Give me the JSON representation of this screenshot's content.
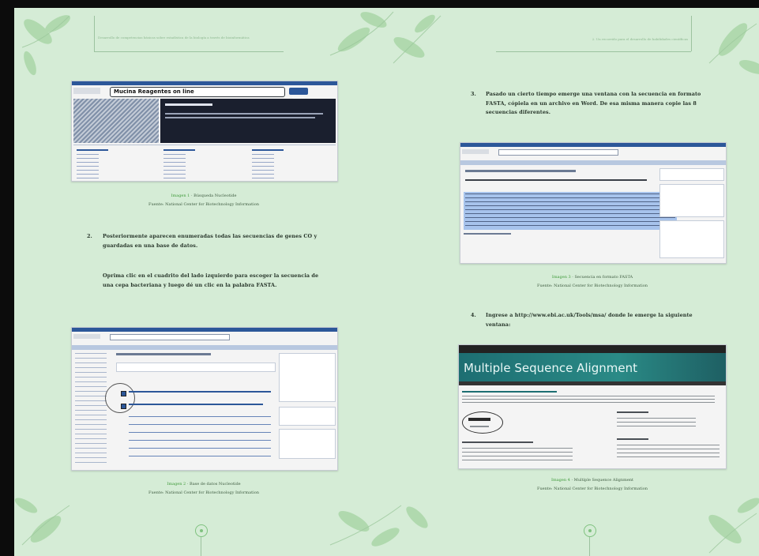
{
  "left_page": {
    "header": "Desarrollo de competencias básicas sobre estadística de la biología a través de bioinformática",
    "figure1": {
      "search_query": "Mucina Reagentes on line",
      "search_button": "Search",
      "caption_label": "Imagen 1",
      "caption_title": "Búsqueda Nucleotide",
      "source": "Fuente: National Center for Biotechnology Information"
    },
    "step2": {
      "number": "2.",
      "text_a": "Posteriormente aparecen enumeradas todas las secuencias de genes CO y guardadas en una base de datos.",
      "text_b": "Oprima clic en el cuadrito del lado izquierdo para escoger la secuencia de una cepa bacteriana y luego dé un clic en la palabra FASTA."
    },
    "figure2": {
      "caption_label": "Imagen 2",
      "caption_title": "Base de datos Nucleotide",
      "source": "Fuente: National Center for Biotechnology Information"
    }
  },
  "right_page": {
    "header": "2. Un recorrido para el desarrollo de habilidades científicas",
    "step3": {
      "number": "3.",
      "text": "Pasado un cierto tiempo emerge una ventana con la secuencia en formato FASTA, cópiela en un archivo en Word. De esa misma manera copie las 8 secuencias diferentes."
    },
    "figure3": {
      "caption_label": "Imagen 3",
      "caption_title": "Secuencia en formato FASTA",
      "source": "Fuente: National Center for Biotechnology Information"
    },
    "step4": {
      "number": "4.",
      "text": "Ingrese a http://www.ebi.ac.uk/Tools/msa/ donde le emerge la siguiente ventana:"
    },
    "figure4": {
      "banner_title": "Multiple Sequence Alignment",
      "caption_label": "Imagen 4",
      "caption_title": "Multiple Sequence Alignment",
      "source": "Fuente: National Center for Biotechnology Information"
    }
  },
  "colors": {
    "page_bg": "#d5ecd6",
    "leaf": "#a9d6a7",
    "accent": "#3f9a3a",
    "ncbi_blue": "#2c5799",
    "ebi_teal": "#1d6e72"
  }
}
